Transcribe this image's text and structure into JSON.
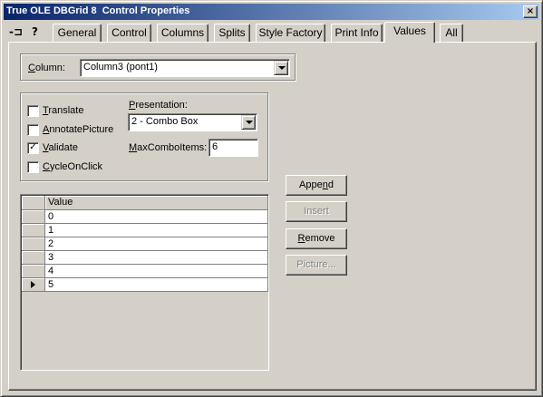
{
  "window": {
    "title": "True OLE DBGrid 8  Control Properties",
    "close_symbol": "×"
  },
  "toolbar": {
    "pin_icon": "-⊐",
    "help_icon": "?"
  },
  "tabs": [
    {
      "label": "General"
    },
    {
      "label": "Control"
    },
    {
      "label": "Columns"
    },
    {
      "label": "Splits"
    },
    {
      "label": "Style Factory"
    },
    {
      "label": "Print Info"
    },
    {
      "label": "Values"
    },
    {
      "label": "All"
    }
  ],
  "column": {
    "label_u": "C",
    "label_rest": "olumn:",
    "value": "Column3 (pont1)"
  },
  "options": {
    "translate": {
      "u": "T",
      "rest": "ranslate",
      "checked": false
    },
    "annotate": {
      "u": "A",
      "rest": "nnotatePicture",
      "checked": false
    },
    "validate": {
      "u": "V",
      "rest": "alidate",
      "checked": true,
      "mark": "✓"
    },
    "cycle": {
      "u": "C",
      "rest": "ycleOnClick",
      "checked": false
    }
  },
  "presentation": {
    "label_u": "P",
    "label_rest": "resentation:",
    "value": "2 - Combo Box"
  },
  "maxcombo": {
    "label_u": "M",
    "label_rest": "axComboItems:",
    "value": "6"
  },
  "buttons": {
    "append": {
      "pre": "Appe",
      "u": "n",
      "post": "d",
      "enabled": true
    },
    "insert": {
      "label": "Insert",
      "enabled": false
    },
    "remove": {
      "u": "R",
      "rest": "emove",
      "enabled": true
    },
    "picture": {
      "label": "Picture...",
      "enabled": false
    }
  },
  "grid": {
    "header": "Value",
    "rows": [
      "0",
      "1",
      "2",
      "3",
      "4",
      "5"
    ],
    "current_row": 5
  }
}
